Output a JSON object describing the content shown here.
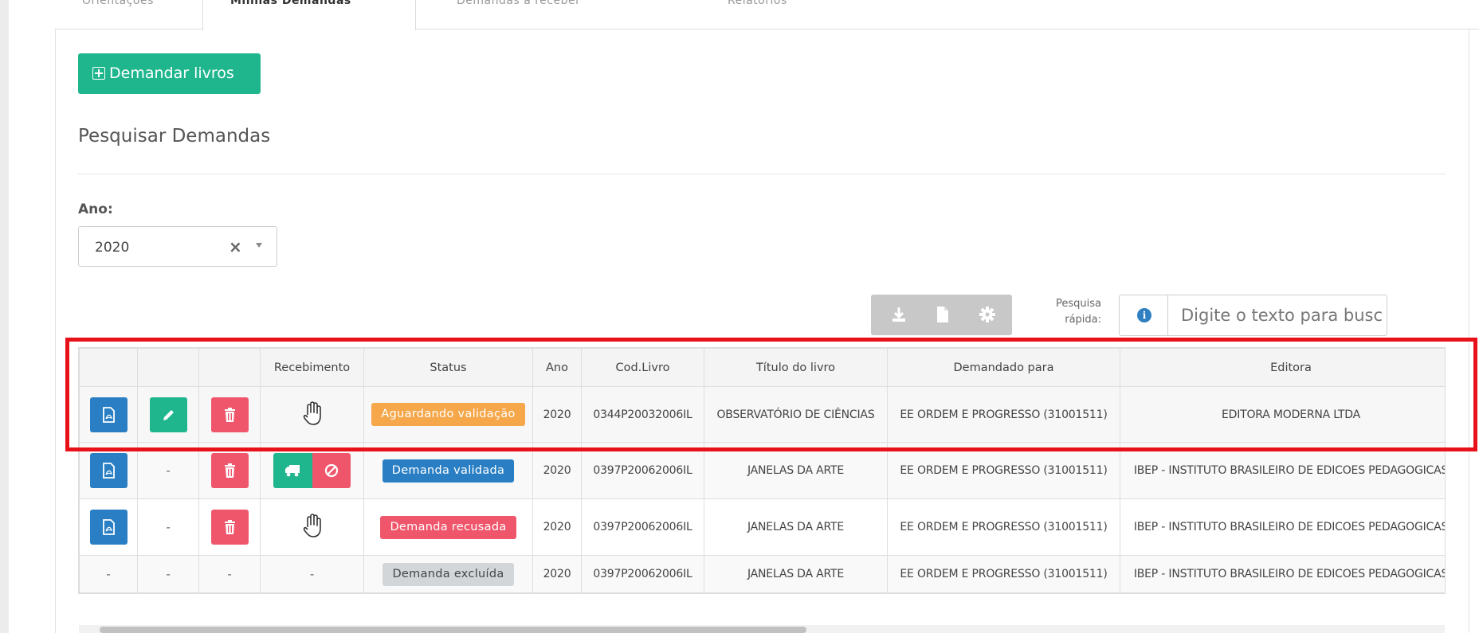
{
  "tabs": [
    {
      "label": "Orientações",
      "active": false
    },
    {
      "label": "Minhas Demandas",
      "active": true
    },
    {
      "label": "Demandas a receber",
      "active": false
    },
    {
      "label": "Relatórios",
      "active": false
    }
  ],
  "demandar_button": {
    "label": "Demandar livros",
    "icon": "plus-square-icon"
  },
  "section_title": "Pesquisar Demandas",
  "ano_filter": {
    "label": "Ano:",
    "value": "2020"
  },
  "toolbar": {
    "icons": [
      "download-icon",
      "file-icon",
      "gear-icon"
    ]
  },
  "search": {
    "label_line1": "Pesquisa",
    "label_line2": "rápida:",
    "placeholder": "Digite o texto para busc"
  },
  "table": {
    "columns": [
      "",
      "",
      "",
      "Recebimento",
      "Status",
      "Ano",
      "Cod.Livro",
      "Título do livro",
      "Demandado para",
      "Editora"
    ],
    "rows": [
      {
        "actions": [
          "pdf",
          "edit",
          "delete"
        ],
        "recebimento": "hand",
        "status": "Aguardando validação",
        "status_color": "#f5a74a",
        "ano": "2020",
        "cod": "0344P20032006IL",
        "titulo": "OBSERVATÓRIO DE CIÊNCIAS",
        "demandado": "EE ORDEM E PROGRESSO (31001511)",
        "editora": "EDITORA MODERNA LTDA"
      },
      {
        "actions": [
          "pdf",
          "-",
          "delete"
        ],
        "recebimento": "truck-cancel",
        "status": "Demanda validada",
        "status_color": "#2a7fc4",
        "ano": "2020",
        "cod": "0397P20062006IL",
        "titulo": "JANELAS DA ARTE",
        "demandado": "EE ORDEM E PROGRESSO (31001511)",
        "editora": "IBEP - INSTITUTO BRASILEIRO DE EDICOES PEDAGOGICAS"
      },
      {
        "actions": [
          "pdf",
          "-",
          "delete"
        ],
        "recebimento": "hand",
        "status": "Demanda recusada",
        "status_color": "#f0566b",
        "ano": "2020",
        "cod": "0397P20062006IL",
        "titulo": "JANELAS DA ARTE",
        "demandado": "EE ORDEM E PROGRESSO (31001511)",
        "editora": "IBEP - INSTITUTO BRASILEIRO DE EDICOES PEDAGOGICAS"
      },
      {
        "actions": [
          "-",
          "-",
          "-"
        ],
        "recebimento": "-",
        "status": "Demanda excluída",
        "status_color": "#d2d6d9",
        "ano": "2020",
        "cod": "0397P20062006IL",
        "titulo": "JANELAS DA ARTE",
        "demandado": "EE ORDEM E PROGRESSO (31001511)",
        "editora": "IBEP - INSTITUTO BRASILEIRO DE EDICOES PEDAGOGICAS"
      }
    ]
  },
  "dash": "-",
  "colors": {
    "brand_green": "#1fb68e",
    "primary_blue": "#2a7fc4",
    "danger_red": "#f0566b",
    "warning_orange": "#f5a74a",
    "highlight_red": "#e8111a"
  }
}
